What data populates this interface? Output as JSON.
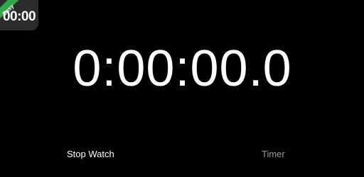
{
  "app_icon": {
    "badge": "Easy",
    "time": "00:00"
  },
  "display": {
    "main": "0:00:00",
    "separator": ".",
    "tenths": "0"
  },
  "tabs": [
    {
      "label": "Stop Watch",
      "active": true
    },
    {
      "label": "Timer",
      "active": false
    }
  ],
  "colors": {
    "background": "#000000",
    "text": "#ffffff",
    "inactive_tab": "#9a9a9a",
    "badge": "#2fa845"
  }
}
